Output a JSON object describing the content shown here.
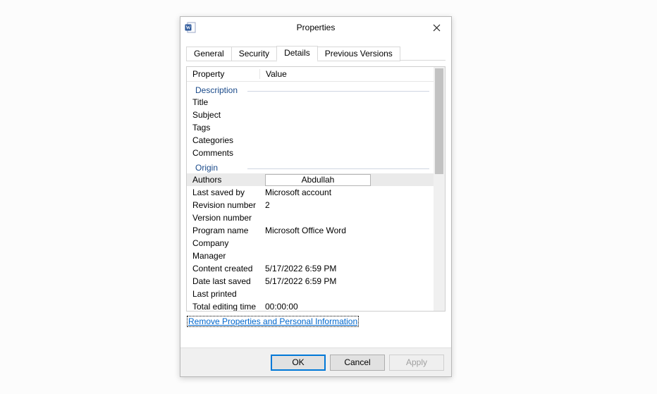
{
  "titlebar": {
    "title": "Properties"
  },
  "tabs": {
    "general": "General",
    "security": "Security",
    "details": "Details",
    "previous": "Previous Versions"
  },
  "columns": {
    "property": "Property",
    "value": "Value"
  },
  "groups": {
    "description": "Description",
    "origin": "Origin"
  },
  "rows": {
    "title": {
      "label": "Title",
      "value": ""
    },
    "subject": {
      "label": "Subject",
      "value": ""
    },
    "tags": {
      "label": "Tags",
      "value": ""
    },
    "categories": {
      "label": "Categories",
      "value": ""
    },
    "comments": {
      "label": "Comments",
      "value": ""
    },
    "authors": {
      "label": "Authors",
      "value": "Abdullah"
    },
    "last_saved_by": {
      "label": "Last saved by",
      "value": "Microsoft account"
    },
    "revision_number": {
      "label": "Revision number",
      "value": "2"
    },
    "version_number": {
      "label": "Version number",
      "value": ""
    },
    "program_name": {
      "label": "Program name",
      "value": "Microsoft Office Word"
    },
    "company": {
      "label": "Company",
      "value": ""
    },
    "manager": {
      "label": "Manager",
      "value": ""
    },
    "content_created": {
      "label": "Content created",
      "value": "5/17/2022 6:59 PM"
    },
    "date_last_saved": {
      "label": "Date last saved",
      "value": "5/17/2022 6:59 PM"
    },
    "last_printed": {
      "label": "Last printed",
      "value": ""
    },
    "total_editing": {
      "label": "Total editing time",
      "value": "00:00:00"
    }
  },
  "link": {
    "remove": "Remove Properties and Personal Information"
  },
  "buttons": {
    "ok": "OK",
    "cancel": "Cancel",
    "apply": "Apply"
  }
}
